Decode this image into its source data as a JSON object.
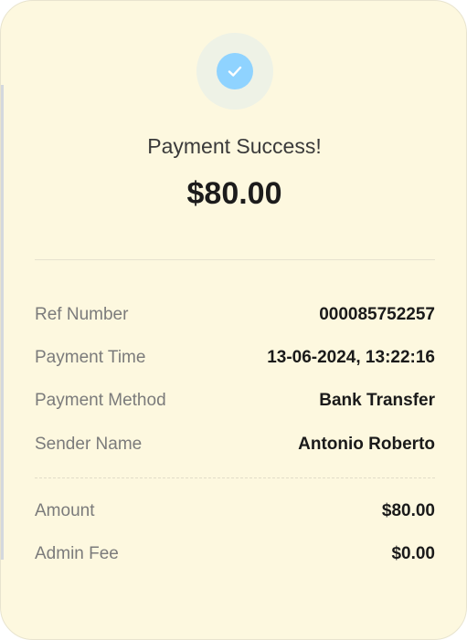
{
  "receipt": {
    "status_icon": "check-icon",
    "title": "Payment Success!",
    "amount": "$80.00",
    "details": [
      {
        "label": "Ref Number",
        "value": "000085752257"
      },
      {
        "label": "Payment Time",
        "value": "13-06-2024, 13:22:16"
      },
      {
        "label": "Payment Method",
        "value": "Bank Transfer"
      },
      {
        "label": "Sender Name",
        "value": "Antonio Roberto"
      }
    ],
    "charges": [
      {
        "label": "Amount",
        "value": "$80.00"
      },
      {
        "label": "Admin Fee",
        "value": "$0.00"
      }
    ]
  },
  "colors": {
    "card_background": "#fdf8df",
    "check_circle": "#8fd3ff",
    "check_halo": "#eef2e6",
    "label_text": "#7b7b7b",
    "value_text": "#1a1a1a"
  }
}
